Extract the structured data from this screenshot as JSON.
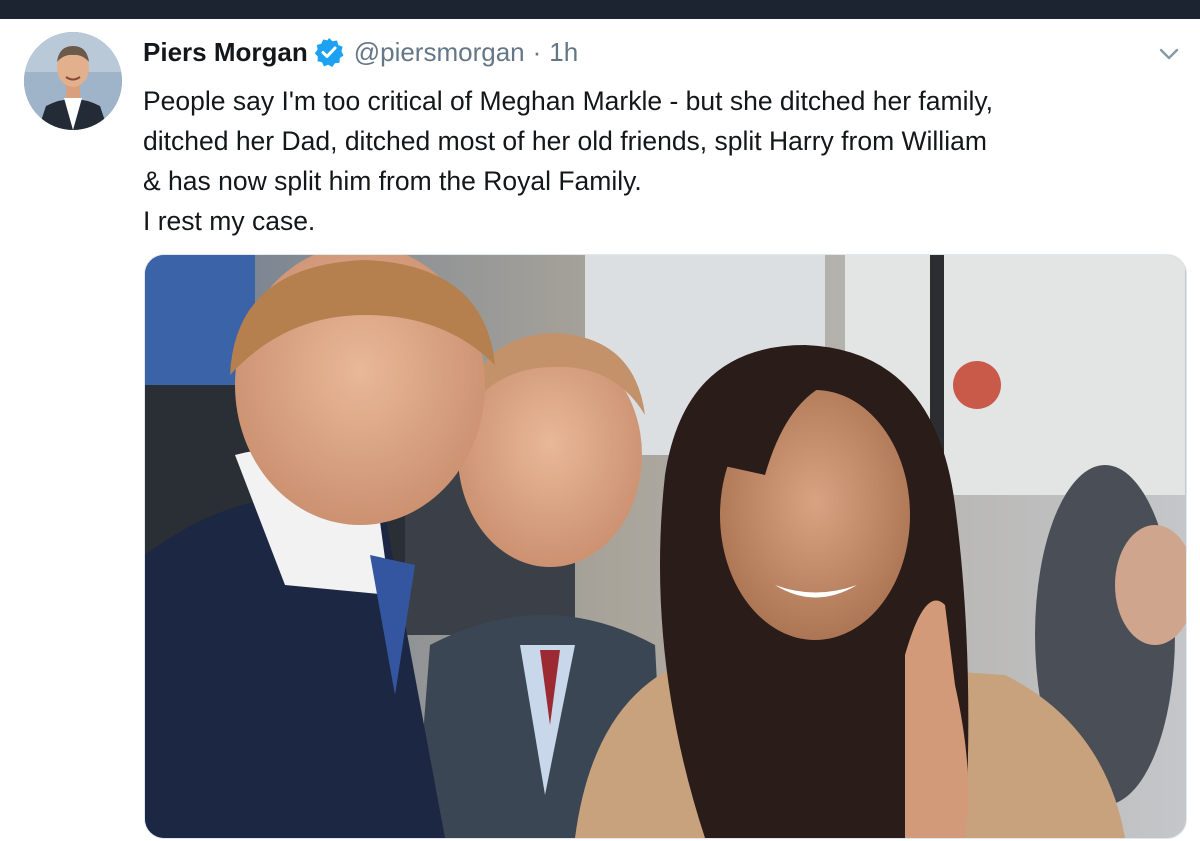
{
  "tweet": {
    "display_name": "Piers Morgan",
    "handle": "@piersmorgan",
    "separator": "·",
    "time": "1h",
    "text_lines": [
      "People say I'm too critical of Meghan Markle - but she ditched her family,",
      "ditched her Dad, ditched most of her old friends, split Harry from William",
      "& has now split him from the Royal Family.",
      "I rest my case."
    ]
  },
  "icons": {
    "verified": "verified-badge-icon",
    "caret": "chevron-down-icon"
  },
  "colors": {
    "top_bar": "#1b2430",
    "name": "#14171a",
    "secondary": "#657786",
    "verified": "#1da1f2"
  }
}
